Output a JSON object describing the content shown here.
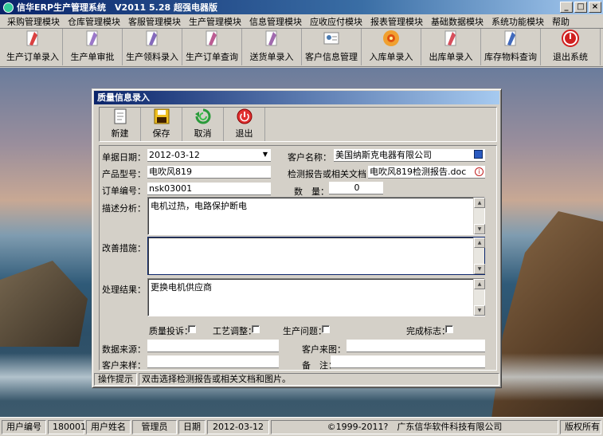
{
  "window": {
    "title": "信华ERP生产管理系统　V2011 5.28 超强电器版",
    "minimize": "_",
    "maximize": "□",
    "close": "×"
  },
  "menu": [
    "采购管理模块",
    "仓库管理模块",
    "客服管理模块",
    "生产管理模块",
    "信息管理模块",
    "应收应付模块",
    "报表管理模块",
    "基础数据模块",
    "系统功能模块",
    "帮助"
  ],
  "toolbar": [
    {
      "label": "生产订单录入",
      "icon": "pdf-document-icon",
      "color": "#d42020"
    },
    {
      "label": "生产单审批",
      "icon": "approve-document-icon",
      "color": "#8a60c0"
    },
    {
      "label": "生产领料录入",
      "icon": "material-document-icon",
      "color": "#7050b0"
    },
    {
      "label": "生产订单查询",
      "icon": "query-document-icon",
      "color": "#b04080"
    },
    {
      "label": "送货单录入",
      "icon": "delivery-document-icon",
      "color": "#9050a0"
    },
    {
      "label": "客户信息管理",
      "icon": "customer-card-icon",
      "color": "#4a7ab0"
    },
    {
      "label": "入库单录入",
      "icon": "flower-icon",
      "color": "#e08020"
    },
    {
      "label": "出库单录入",
      "icon": "outbound-pen-icon",
      "color": "#d03040"
    },
    {
      "label": "库存物料查询",
      "icon": "feather-pen-icon",
      "color": "#2050b0"
    },
    {
      "label": "退出系统",
      "icon": "exit-power-icon",
      "color": "#d02020"
    }
  ],
  "dialog": {
    "title": "质量信息录入",
    "buttons": [
      {
        "label": "新建",
        "icon": "new-document-icon"
      },
      {
        "label": "保存",
        "icon": "save-disk-icon"
      },
      {
        "label": "取消",
        "icon": "cancel-arrows-icon"
      },
      {
        "label": "退出",
        "icon": "exit-power-icon"
      }
    ],
    "fields": {
      "date_label": "单据日期：",
      "date": "2012-03-12",
      "customer_label": "客户名称：",
      "customer": "美国纳斯克电器有限公司",
      "model_label": "产品型号：",
      "model": "电吹风819",
      "report_label": "检测报告或相关文档：",
      "report": "电吹风819检测报告.doc",
      "order_label": "订单编号：",
      "order": "nsk03001",
      "qty_label": "数　量：",
      "qty": "0",
      "desc_label": "描述分析：",
      "desc": "电机过热，电路保护断电",
      "improve_label": "改善措施：",
      "improve": "",
      "result_label": "处理结果：",
      "result": "更换电机供应商",
      "cb_complaint": "质量投诉：",
      "cb_process": "工艺调整：",
      "cb_production": "生产问题：",
      "cb_done": "完成标志：",
      "source_label": "数据来源：",
      "source": "",
      "customer_img_label": "客户来图：",
      "customer_img": "",
      "sample_label": "客户来样：",
      "sample": "",
      "note_label": "备　注：",
      "note": ""
    },
    "hint_label": "操作提示",
    "hint_text": "双击选择检测报告或相关文档和图片。"
  },
  "status": {
    "user_id_label": "用户编号",
    "user_id": "180001",
    "user_name_label": "用户姓名",
    "user_name": "管理员",
    "date_label": "日期",
    "date": "2012-03-12",
    "copyright": "©1999-2011?　广东信华软件科技有限公司",
    "rights": "版权所有"
  }
}
